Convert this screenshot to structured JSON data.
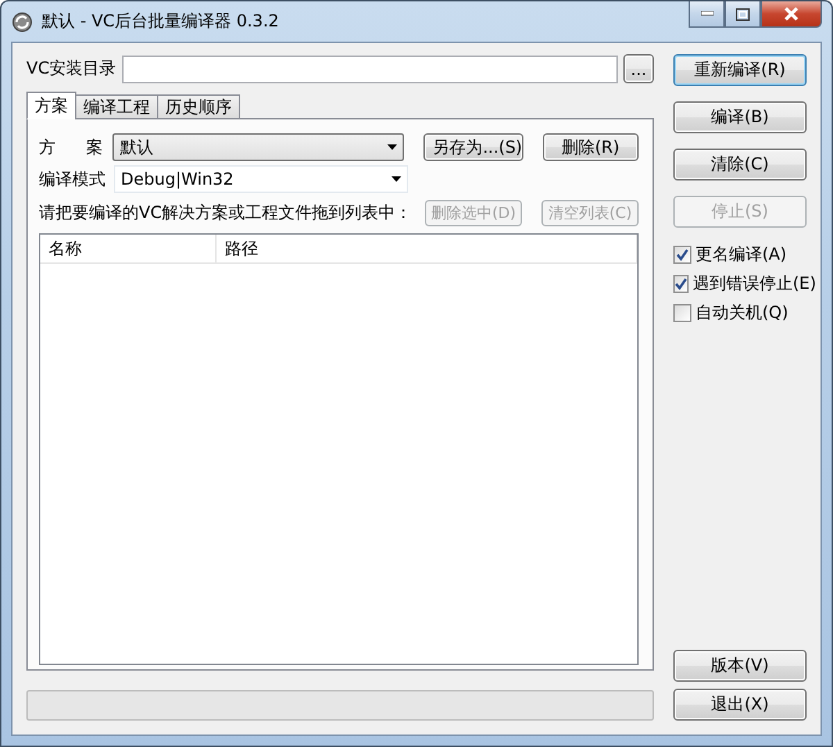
{
  "window": {
    "title": "默认 - VC后台批量编译器 0.3.2"
  },
  "vc_dir": {
    "label": "VC安装目录",
    "browse": "..."
  },
  "tabs": [
    {
      "label": "方案",
      "selected": true
    },
    {
      "label": "编译工程",
      "selected": false
    },
    {
      "label": "历史顺序",
      "selected": false
    }
  ],
  "scheme": {
    "label": "方 案",
    "value": "默认",
    "buttons": [
      {
        "label": "另存为...(S)",
        "disabled": false
      },
      {
        "label": "删除(R)",
        "disabled": false
      }
    ]
  },
  "mode": {
    "label": "编译模式",
    "value": "Debug|Win32"
  },
  "instruction": "请把要编译的VC解决方案或工程文件拖到列表中：",
  "list_buttons": [
    {
      "label": "删除选中(D)",
      "disabled": true
    },
    {
      "label": "清空列表(C)",
      "disabled": true
    }
  ],
  "list": {
    "columns": [
      "名称",
      "路径"
    ]
  },
  "actions": [
    {
      "label": "重新编译(R)",
      "disabled": false,
      "default": true
    },
    {
      "label": "编译(B)",
      "disabled": false,
      "default": false
    },
    {
      "label": "清除(C)",
      "disabled": false,
      "default": false
    },
    {
      "label": "停止(S)",
      "disabled": true,
      "default": false
    }
  ],
  "options": [
    {
      "label": "更名编译(A)",
      "checked": true
    },
    {
      "label": "遇到错误停止(E)",
      "checked": true
    },
    {
      "label": "自动关机(Q)",
      "checked": false
    }
  ],
  "bottom_buttons": [
    {
      "label": "版本(V)",
      "disabled": false
    },
    {
      "label": "退出(X)",
      "disabled": false
    }
  ]
}
